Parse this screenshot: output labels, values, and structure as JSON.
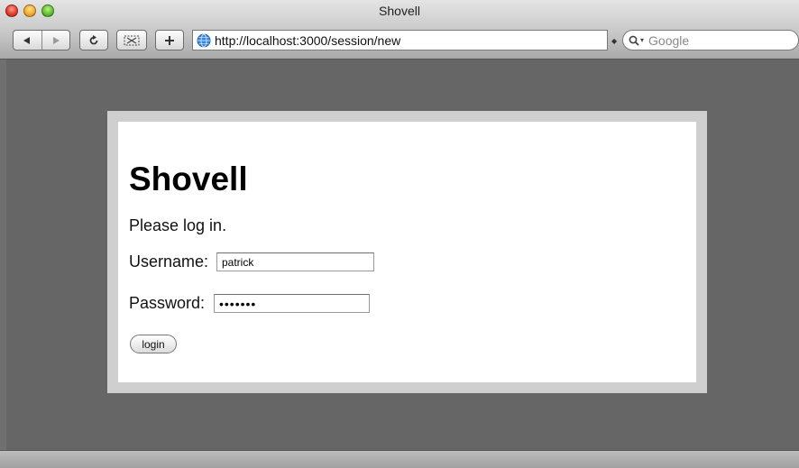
{
  "window": {
    "title": "Shovell"
  },
  "toolbar": {
    "back_icon": "back-arrow-icon",
    "forward_icon": "forward-arrow-icon",
    "reload_icon": "reload-icon",
    "snip_icon": "snippet-icon",
    "add_icon": "add-bookmark-icon",
    "address_url": "http://localhost:3000/session/new",
    "search_placeholder": "Google"
  },
  "page": {
    "heading": "Shovell",
    "intro": "Please log in.",
    "username_label": "Username:",
    "username_value": "patrick",
    "password_label": "Password:",
    "password_value": "•••••••",
    "login_label": "login"
  },
  "colors": {
    "desktop_background": "#666666",
    "frame_border": "#cfcfcf",
    "card_background": "#ffffff"
  }
}
